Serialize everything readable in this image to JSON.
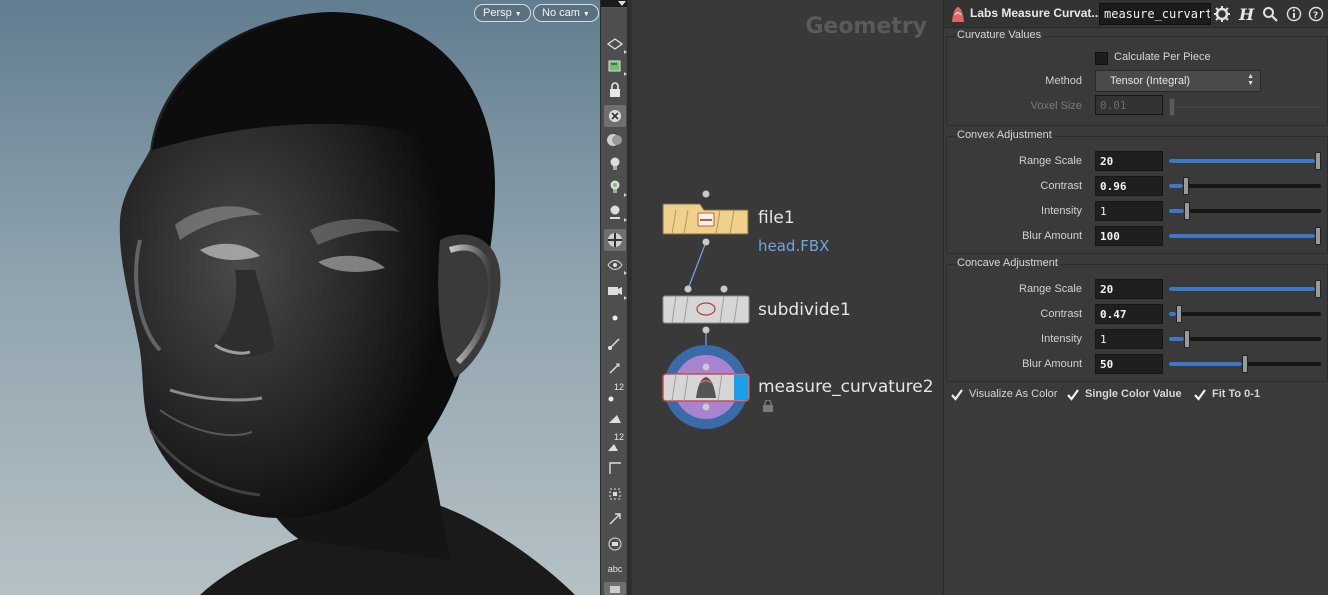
{
  "viewport": {
    "persp_label": "Persp",
    "camera_label": "No cam"
  },
  "toolbar": {
    "icons": [
      "display-options-icon",
      "shading-icon",
      "lock-icon",
      "ghost-icon",
      "background-icon",
      "lights-icon",
      "light-link-icon",
      "light-icon",
      "render-icon",
      "visualizer-icon",
      "camera-options-icon",
      "point-display-icon",
      "normal-display-icon",
      "vector-display-icon",
      "point-numbers-icon",
      "primitive-normals-icon",
      "primitive-numbers-icon",
      "edge-icon",
      "snap-icon",
      "handle-icon",
      "template-icon",
      "text-display-icon",
      "shelf-icon"
    ],
    "point_number_label": "12",
    "prim_number_label": "12",
    "text_label": "abc"
  },
  "network": {
    "context_label": "Geometry",
    "nodes": [
      {
        "name": "file1",
        "subtitle": "head.FBX"
      },
      {
        "name": "subdivide1"
      },
      {
        "name": "measure_curvature2"
      }
    ]
  },
  "params": {
    "node_type": "Labs Measure Curvat...",
    "node_name": "measure_curvart",
    "header_icons": [
      "gear-icon",
      "houdini-help-icon",
      "search-icon",
      "info-icon",
      "help-icon"
    ],
    "curvature": {
      "title": "Curvature Values",
      "calc_per_piece_label": "Calculate Per Piece",
      "calc_per_piece": false,
      "method_label": "Method",
      "method_value": "Tensor (Integral)",
      "voxel_label": "Voxel Size",
      "voxel_value": "0.01"
    },
    "convex": {
      "title": "Convex Adjustment",
      "rows": [
        {
          "label": "Range Scale",
          "value": "20",
          "slider": 1.0
        },
        {
          "label": "Contrast",
          "value": "0.96",
          "slider": 0.096
        },
        {
          "label": "Intensity",
          "value": "1",
          "slider": 0.1
        },
        {
          "label": "Blur Amount",
          "value": "100",
          "slider": 1.0
        }
      ]
    },
    "concave": {
      "title": "Concave Adjustment",
      "rows": [
        {
          "label": "Range Scale",
          "value": "20",
          "slider": 1.0
        },
        {
          "label": "Contrast",
          "value": "0.47",
          "slider": 0.047
        },
        {
          "label": "Intensity",
          "value": "1",
          "slider": 0.1
        },
        {
          "label": "Blur Amount",
          "value": "50",
          "slider": 0.5
        }
      ]
    },
    "toggles": [
      {
        "label": "Visualize As Color",
        "checked": true
      },
      {
        "label": "Single Color Value",
        "checked": true
      },
      {
        "label": "Fit To 0-1",
        "checked": true
      }
    ]
  }
}
